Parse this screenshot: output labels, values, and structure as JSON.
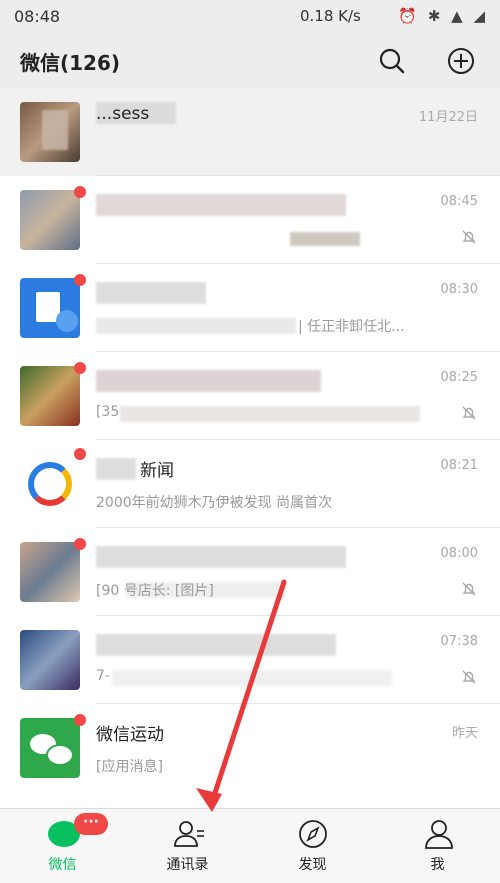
{
  "status_bar": {
    "time": "08:48",
    "speed": "0.18 K/s",
    "icons": "⏰ ✱ ▲ ◢"
  },
  "header": {
    "title": "微信(126)"
  },
  "chats": [
    {
      "name": "...sess",
      "preview": "",
      "time": "11月22日"
    },
    {
      "name": "",
      "preview": "",
      "time": "08:45"
    },
    {
      "name": "",
      "preview": "| 任正非卸任北...",
      "time": "08:30"
    },
    {
      "name": "",
      "preview": "[35",
      "time": "08:25"
    },
    {
      "name": "新闻",
      "preview": "2000年前幼狮木乃伊被发现 尚属首次",
      "time": "08:21"
    },
    {
      "name": "",
      "preview": "[90  号店长: [图片]",
      "time": "08:00"
    },
    {
      "name": "",
      "preview": "7-",
      "time": "07:38"
    },
    {
      "name": "微信运动",
      "preview": "[应用消息]",
      "time": "昨天"
    }
  ],
  "tabs": [
    {
      "label": "微信",
      "badge": "···"
    },
    {
      "label": "通讯录"
    },
    {
      "label": "发现"
    },
    {
      "label": "我"
    }
  ],
  "colors": {
    "accent": "#07c160",
    "badge": "#f04747",
    "arrow": "#e83a3a"
  }
}
